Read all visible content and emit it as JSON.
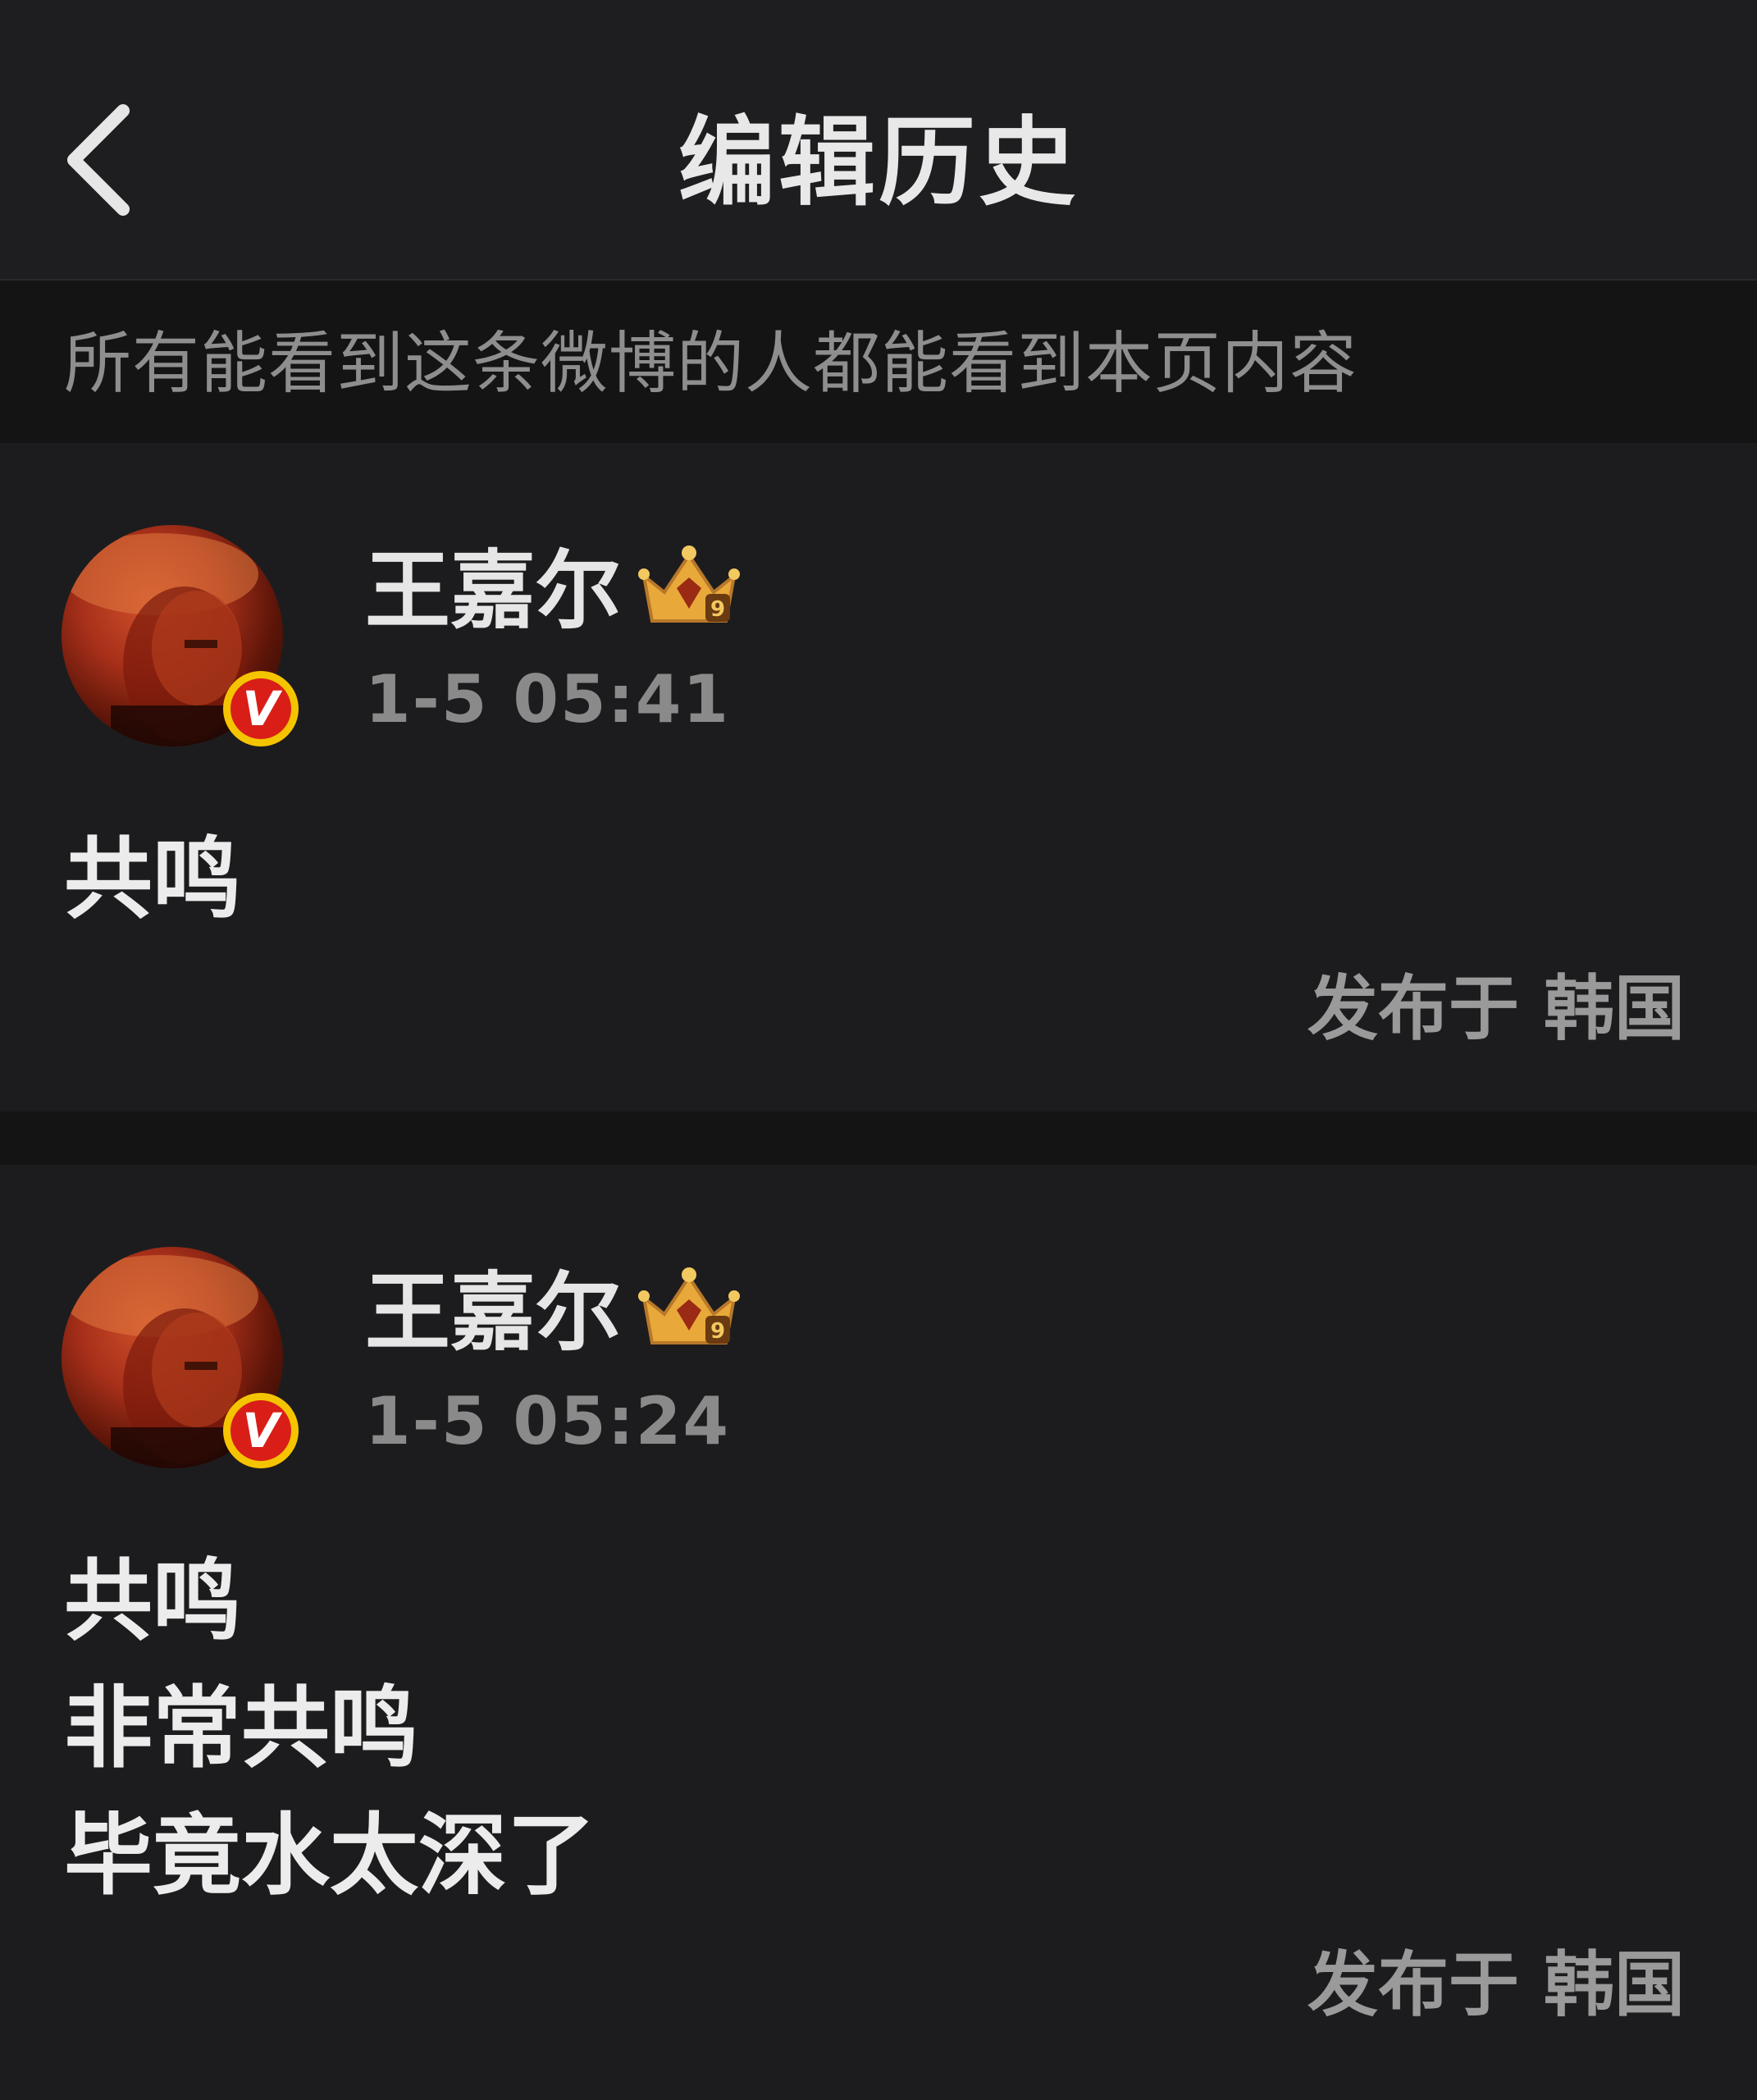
{
  "header": {
    "title": "编辑历史",
    "back_icon": "chevron-left-icon"
  },
  "notice": {
    "text": "所有能看到这条微博的人都能看到本页内容"
  },
  "versions": [
    {
      "username": "王嘉尔",
      "timestamp": "1-5 05:41",
      "lines": [
        "共鸣"
      ],
      "location": "发布于 韩国",
      "verified_badge": "V",
      "level_badge": "9"
    },
    {
      "username": "王嘉尔",
      "timestamp": "1-5 05:24",
      "lines": [
        "共鸣",
        "非常共鸣",
        "毕竟水太深了"
      ],
      "location": "发布于 韩国",
      "verified_badge": "V",
      "level_badge": "9"
    }
  ],
  "colors": {
    "background": "#1c1c1e",
    "notice_background": "#141414",
    "verified_red": "#d91e18",
    "verified_gold": "#f5c400",
    "crown_gold": "#e8a93a"
  }
}
